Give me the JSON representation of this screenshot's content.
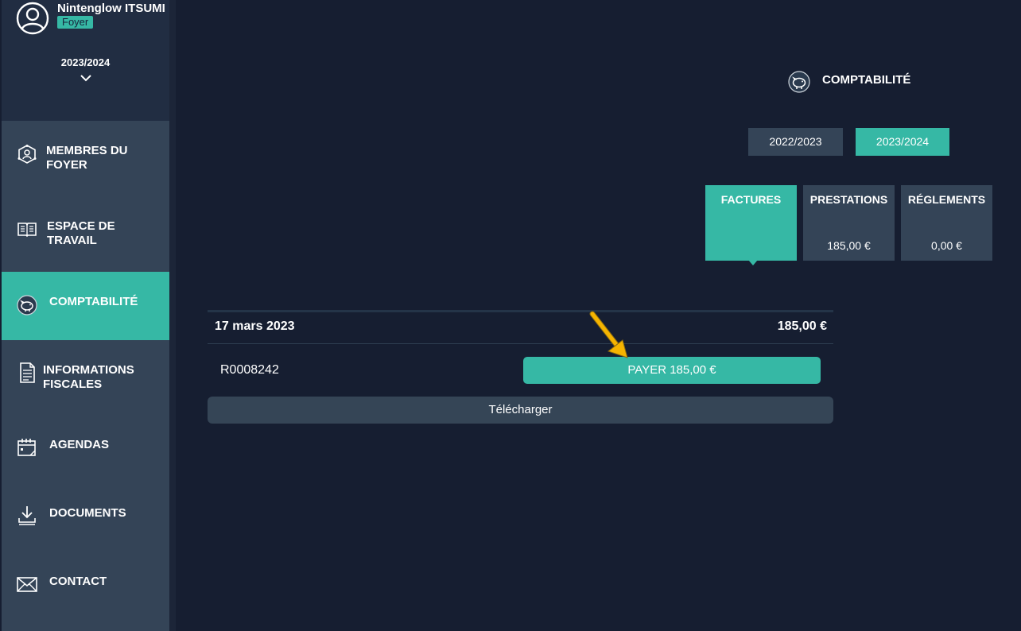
{
  "user": {
    "name": "Nintenglow ITSUMI",
    "badge": "Foyer"
  },
  "year_selector": "2023/2024",
  "sidebar": {
    "items": [
      {
        "line1": "MEMBRES DU",
        "line2": "FOYER",
        "icon": "users-network-icon"
      },
      {
        "line1": "ESPACE DE",
        "line2": "TRAVAIL",
        "icon": "open-book-icon"
      },
      {
        "line1": "COMPTABILITÉ",
        "line2": "",
        "icon": "piggy-bank-icon",
        "active": true
      },
      {
        "line1": "INFORMATIONS",
        "line2": "FISCALES",
        "icon": "document-icon"
      },
      {
        "line1": "AGENDAS",
        "line2": "",
        "icon": "calendar-icon"
      },
      {
        "line1": "DOCUMENTS",
        "line2": "",
        "icon": "download-icon"
      },
      {
        "line1": "CONTACT",
        "line2": "",
        "icon": "envelope-icon"
      }
    ]
  },
  "main": {
    "title": "COMPTABILITÉ",
    "years": [
      "2022/2023",
      "2023/2024"
    ],
    "active_year": "2023/2024",
    "tabs": [
      {
        "label": "FACTURES",
        "value": ""
      },
      {
        "label": "PRESTATIONS",
        "value": "185,00 €"
      },
      {
        "label": "RÉGLEMENTS",
        "value": "0,00 €"
      }
    ],
    "invoice": {
      "date": "17 mars 2023",
      "amount": "185,00 €",
      "reference": "R0008242",
      "pay_label": "PAYER 185,00 €",
      "download_label": "Télécharger"
    }
  },
  "colors": {
    "accent": "#36b8a5",
    "background": "#161e31",
    "sidebar": "#344457",
    "annotation_arrow": "#f5b400"
  }
}
